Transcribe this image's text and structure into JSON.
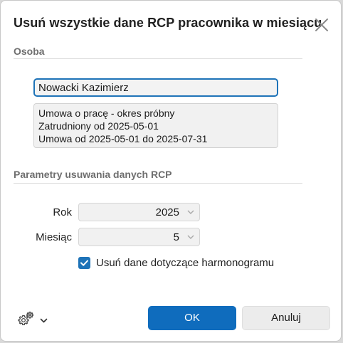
{
  "dialog": {
    "title": "Usuń wszystkie dane RCP pracownika w miesiącu",
    "close_icon": "close-icon"
  },
  "person_section": {
    "label": "Osoba",
    "name_value": "Nowacki Kazimierz",
    "info_lines": [
      "Umowa o pracę - okres próbny",
      "Zatrudniony od 2025-05-01",
      "Umowa od 2025-05-01 do 2025-07-31"
    ]
  },
  "params_section": {
    "label": "Parametry usuwania danych RCP",
    "year_label": "Rok",
    "year_value": "2025",
    "month_label": "Miesiąc",
    "month_value": "5",
    "schedule_checkbox_label": "Usuń dane dotyczące harmonogramu",
    "schedule_checked": true
  },
  "footer": {
    "settings_icon": "gear-icon",
    "ok_label": "OK",
    "cancel_label": "Anuluj"
  },
  "colors": {
    "accent": "#0f6cbd",
    "focus_border": "#1e73b8"
  }
}
